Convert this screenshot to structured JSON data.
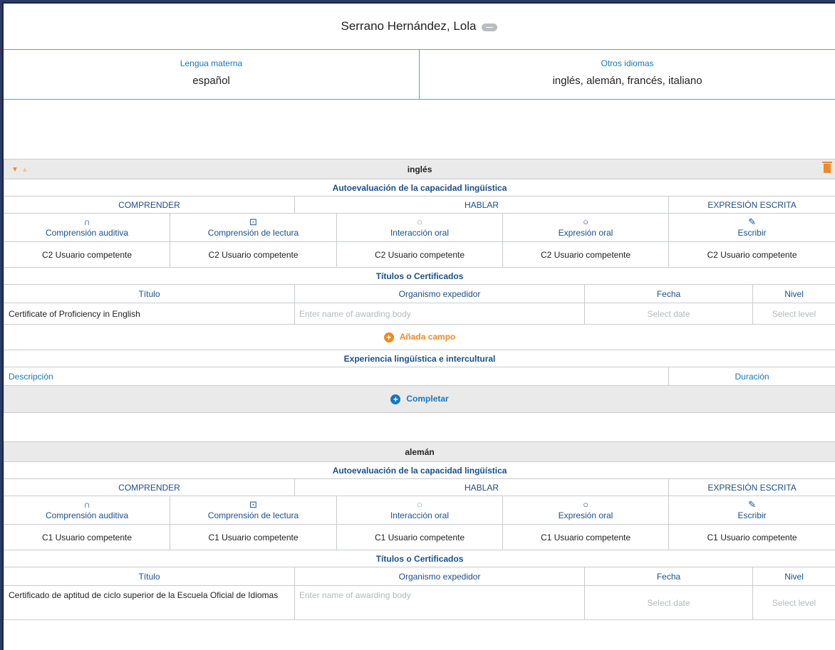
{
  "person": {
    "name": "Serrano Hernández, Lola"
  },
  "languages": {
    "mother_label": "Lengua materna",
    "mother_value": "español",
    "other_label": "Otros idiomas",
    "other_value": "inglés, alemán, francés, italiano"
  },
  "sections": [
    {
      "language": "inglés",
      "self_assessment": "Autoevaluación de la capacidad lingüística",
      "cat_understanding": "COMPRENDER",
      "cat_speaking": "HABLAR",
      "cat_writing": "EXPRESIÓN ESCRITA",
      "skills": [
        {
          "label": "Comprensión auditiva",
          "icon": "headphones-icon",
          "glyph": "∩",
          "level": "C2 Usuario competente"
        },
        {
          "label": "Comprensión de lectura",
          "icon": "book-icon",
          "glyph": "⊡",
          "level": "C2 Usuario competente"
        },
        {
          "label": "Interacción oral",
          "icon": "chat-bubbles-icon",
          "glyph": "◌",
          "level": "C2 Usuario competente"
        },
        {
          "label": "Expresión oral",
          "icon": "speech-bubble-icon",
          "glyph": "○",
          "level": "C2 Usuario competente"
        },
        {
          "label": "Escribir",
          "icon": "pencil-icon",
          "glyph": "✎",
          "level": "C2 Usuario competente"
        }
      ],
      "certs_title": "Títulos o Certificados",
      "col_title": "Título",
      "col_body": "Organismo expedidor",
      "col_date": "Fecha",
      "col_level": "Nivel",
      "cert_title": "Certificate of Proficiency in English",
      "body_placeholder": "Enter name of awarding body",
      "date_placeholder": "Select date",
      "level_placeholder": "Select level",
      "add_field": "Añada campo",
      "experience_title": "Experiencia lingüística e intercultural",
      "col_description": "Descripción",
      "col_duration": "Duración",
      "complete": "Completar"
    },
    {
      "language": "alemán",
      "self_assessment": "Autoevaluación de la capacidad lingüística",
      "cat_understanding": "COMPRENDER",
      "cat_speaking": "HABLAR",
      "cat_writing": "EXPRESIÓN ESCRITA",
      "skills": [
        {
          "label": "Comprensión auditiva",
          "icon": "headphones-icon",
          "glyph": "∩",
          "level": "C1 Usuario competente"
        },
        {
          "label": "Comprensión de lectura",
          "icon": "book-icon",
          "glyph": "⊡",
          "level": "C1 Usuario competente"
        },
        {
          "label": "Interacción oral",
          "icon": "chat-bubbles-icon",
          "glyph": "◌",
          "level": "C1 Usuario competente"
        },
        {
          "label": "Expresión oral",
          "icon": "speech-bubble-icon",
          "glyph": "○",
          "level": "C1 Usuario competente"
        },
        {
          "label": "Escribir",
          "icon": "pencil-icon",
          "glyph": "✎",
          "level": "C1 Usuario competente"
        }
      ],
      "certs_title": "Títulos o Certificados",
      "col_title": "Título",
      "col_body": "Organismo expedidor",
      "col_date": "Fecha",
      "col_level": "Nivel",
      "cert_title": "Certificado de aptitud de ciclo superior de la Escuela Oficial de Idiomas",
      "body_placeholder": "Enter name of awarding body",
      "date_placeholder": "Select date",
      "level_placeholder": "Select level"
    }
  ],
  "colors": {
    "accent_orange": "#f08a24",
    "accent_blue": "#1b77b8",
    "divider": "#4aa9d3"
  }
}
